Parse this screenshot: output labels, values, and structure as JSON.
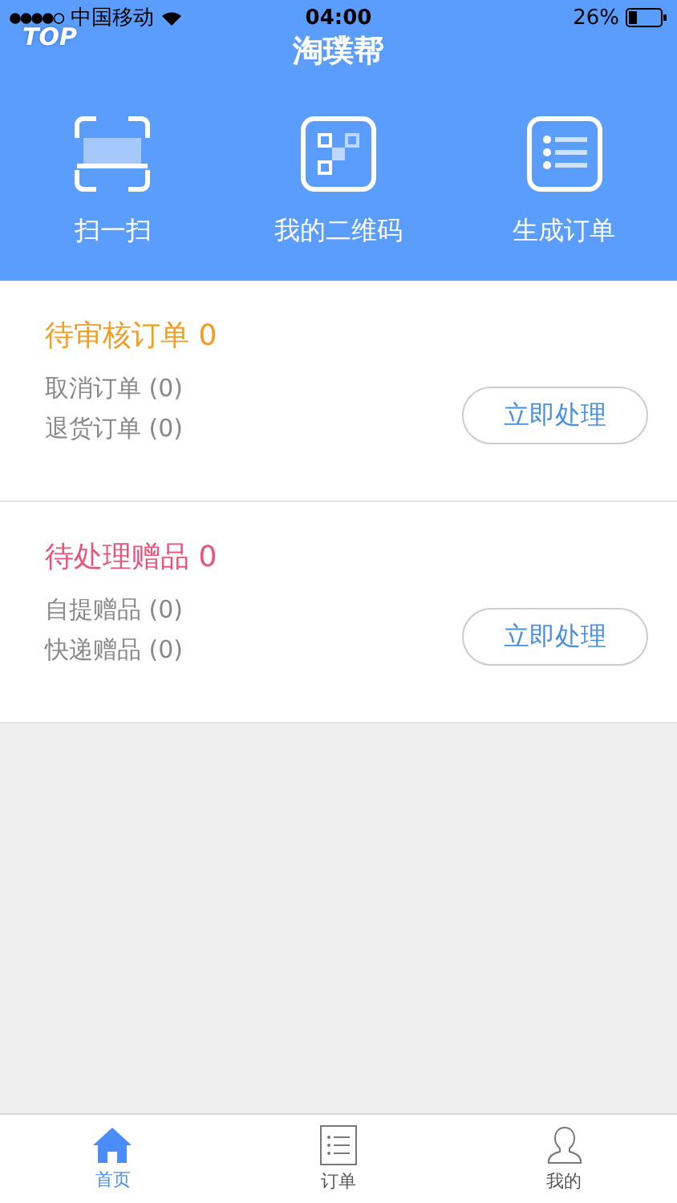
{
  "status_bar": {
    "carrier": "中国移动",
    "time": "04:00",
    "battery": "26%"
  },
  "header": {
    "badge": "TOP",
    "title": "淘璞帮"
  },
  "actions": [
    {
      "kind": "scan",
      "label": "扫一扫"
    },
    {
      "kind": "qr",
      "label": "我的二维码"
    },
    {
      "kind": "list",
      "label": "生成订单"
    }
  ],
  "sections": [
    {
      "title": "待审核订单",
      "count": "0",
      "color": "#f39c1f",
      "lines": [
        {
          "label": "取消订单",
          "count": "(0)"
        },
        {
          "label": "退货订单",
          "count": "(0)"
        }
      ],
      "button": "立即处理"
    },
    {
      "title": "待处理赠品",
      "count": "0",
      "color": "#e9547a",
      "lines": [
        {
          "label": "自提赠品",
          "count": "(0)"
        },
        {
          "label": "快递赠品",
          "count": "(0)"
        }
      ],
      "button": "立即处理"
    }
  ],
  "tab_bar": [
    {
      "kind": "home",
      "label": "首页",
      "selected": true
    },
    {
      "kind": "list",
      "label": "订单",
      "selected": false
    },
    {
      "kind": "person",
      "label": "我的",
      "selected": false
    }
  ]
}
